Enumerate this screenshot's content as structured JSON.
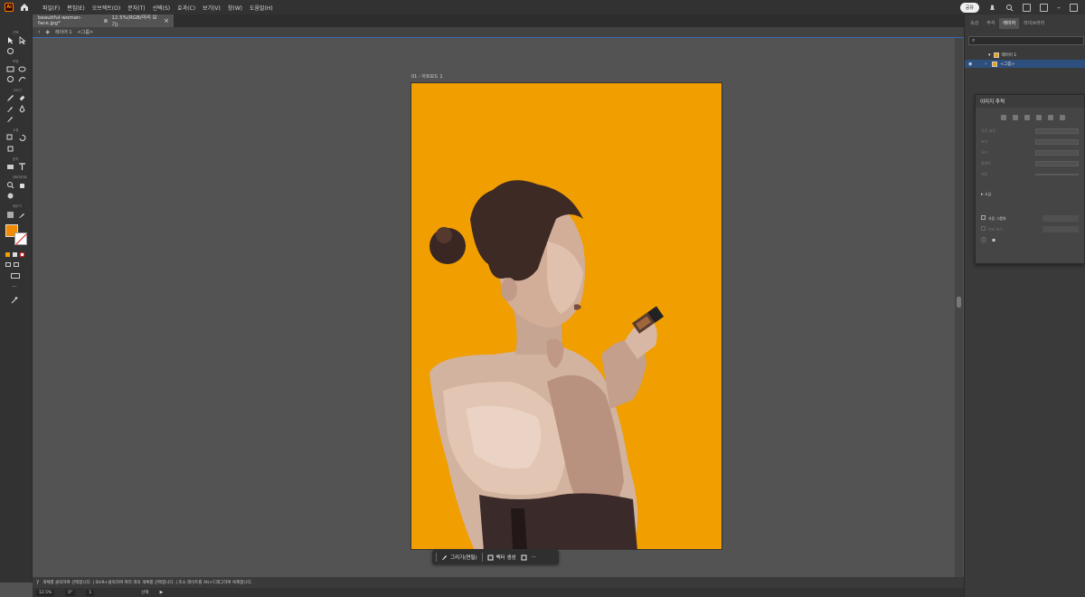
{
  "menubar": {
    "app_logo": "Ai",
    "items": [
      "파일(F)",
      "편집(E)",
      "오브젝트(O)",
      "문자(T)",
      "선택(S)",
      "효과(C)",
      "보기(V)",
      "창(W)",
      "도움말(H)"
    ],
    "share_label": "공유"
  },
  "document": {
    "tab_title": "beautiful-woman-face.jpg*",
    "tab_status": "12.5%(RGB/미리 보기)",
    "close_glyph": "×"
  },
  "controlbar": {
    "breadcrumb_layer": "레이어 1",
    "breadcrumb_group": "<그룹>"
  },
  "toolbar": {
    "section_labels": [
      "선택",
      "모양",
      "그리기",
      "수정",
      "문자",
      "내비게이트",
      "채우기"
    ],
    "more_label": "···"
  },
  "canvas": {
    "artboard_label": "01 - 아트보드 1",
    "artboard_color": "#f09e00"
  },
  "taskbar": {
    "draw_label": "그리기(연필)",
    "vector_label": "벡터 생성",
    "more_label": "···"
  },
  "hint": {
    "text": "개체를 클릭하여 선택합니다. | Shift+클릭하여 여러 개의 개체를 선택합니다. | 조소 레이트를 Alt+드래그하여 복제합니다."
  },
  "status": {
    "zoom": "12.5%",
    "rotation": "0°",
    "artboard_num": "1",
    "tool_name": "선택"
  },
  "right_panel": {
    "tabs": [
      "속성",
      "주석",
      "레이어",
      "라이브러리"
    ],
    "active_tab": "레이어",
    "layers": [
      {
        "name": "레이어 1"
      },
      {
        "name": "<그룹>"
      }
    ]
  },
  "image_trace": {
    "title": "이미지 추적",
    "rows": [
      "사전 설정",
      "보기",
      "모드",
      "팔레트",
      "색상"
    ],
    "advanced_label": "고급",
    "auto_group_label": "자동 그룹화",
    "preview_label": "미리 보기",
    "trace_button": "추적"
  }
}
